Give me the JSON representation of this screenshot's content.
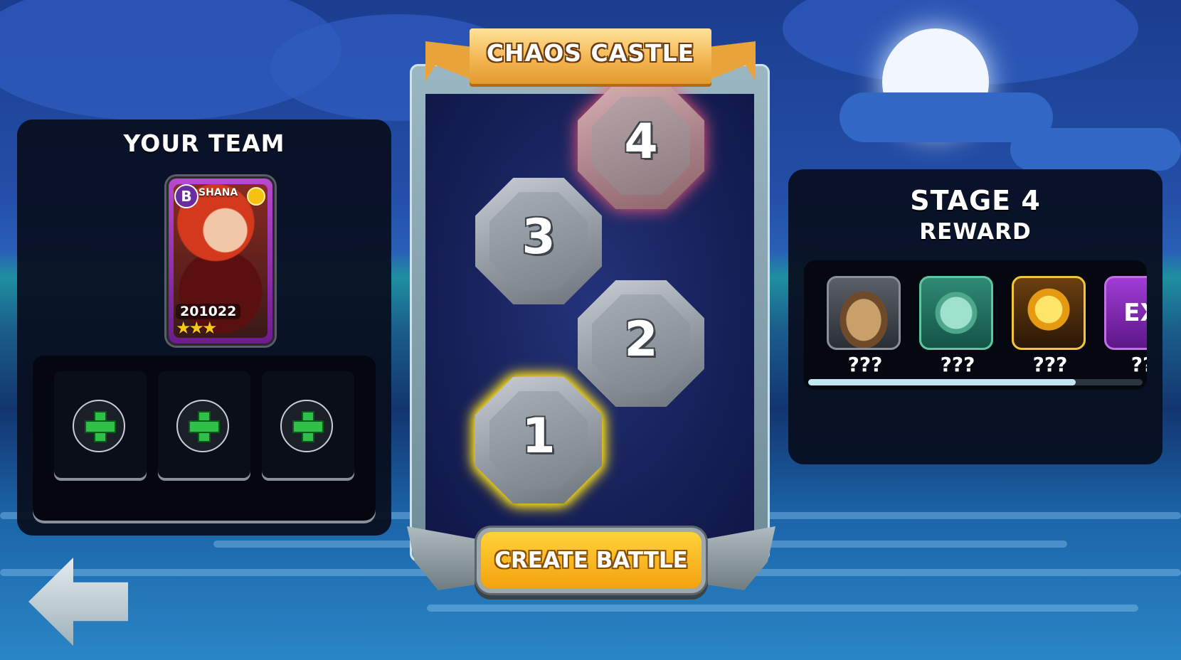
{
  "team_panel": {
    "title": "YOUR TEAM",
    "card": {
      "rarity": "B",
      "name": "SHANA",
      "id": "201022",
      "stars": "★★★"
    },
    "slots": [
      "add-slot",
      "add-slot",
      "add-slot"
    ]
  },
  "castle": {
    "title": "CHAOS CASTLE",
    "stages": [
      {
        "label": "1",
        "state": "current"
      },
      {
        "label": "2",
        "state": "locked"
      },
      {
        "label": "3",
        "state": "locked"
      },
      {
        "label": "4",
        "state": "next"
      }
    ],
    "create_button": "CREATE BATTLE"
  },
  "reward_panel": {
    "title": "STAGE 4",
    "subtitle": "REWARD",
    "rewards": [
      {
        "icon": "treasure-chest-icon",
        "qty": "???"
      },
      {
        "icon": "clover-coin-icon",
        "qty": "???"
      },
      {
        "icon": "gold-gem-icon",
        "qty": "???"
      },
      {
        "icon": "exp-icon",
        "label": "EX",
        "qty": "??"
      }
    ],
    "scroll_fraction": 0.8
  },
  "colors": {
    "accent_gold": "#f3a20e",
    "current_glow": "#ffe11a",
    "next_glow": "#ff5a7a"
  }
}
